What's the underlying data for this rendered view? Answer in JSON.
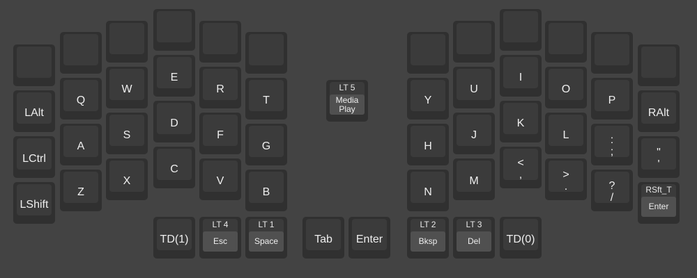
{
  "left_hand": {
    "outer": [
      "",
      "LAlt",
      "LCtrl",
      "LShift"
    ],
    "pinky": [
      "",
      "Q",
      "A",
      "Z"
    ],
    "ring": [
      "",
      "W",
      "S",
      "X"
    ],
    "middle": [
      "",
      "E",
      "D",
      "C"
    ],
    "index": [
      "",
      "R",
      "F",
      "V"
    ],
    "inner": [
      "",
      "T",
      "G",
      "B"
    ],
    "thumbs": [
      {
        "label": "TD(1)"
      },
      {
        "hold": "LT 4",
        "tap": "Esc"
      },
      {
        "hold": "LT 1",
        "tap": "Space"
      },
      {
        "label": "Tab"
      }
    ]
  },
  "center": {
    "hold": "LT 5",
    "tap": "Media\nPlay"
  },
  "right_hand": {
    "inner": [
      "",
      "Y",
      "H",
      "N"
    ],
    "index": [
      "",
      "U",
      "J",
      "M"
    ],
    "middle": [
      "",
      "I",
      "K",
      "<\n,"
    ],
    "ring": [
      "",
      "O",
      "L",
      ">\n."
    ],
    "pinky": [
      "",
      "P",
      ":\n;",
      "?\n/"
    ],
    "outer": [
      "",
      "RAlt",
      "\"\n'",
      {
        "hold": "RSft_T",
        "tap": "Enter"
      }
    ],
    "thumbs": [
      {
        "label": "Enter"
      },
      {
        "hold": "LT 2",
        "tap": "Bksp"
      },
      {
        "hold": "LT 3",
        "tap": "Del"
      },
      {
        "label": "TD(0)"
      }
    ]
  }
}
